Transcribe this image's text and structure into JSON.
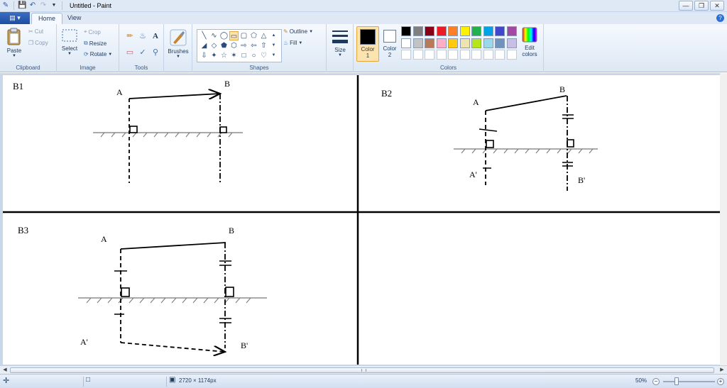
{
  "window": {
    "title": "Untitled - Paint",
    "controls": [
      "minimize",
      "restore",
      "close"
    ]
  },
  "tabs": {
    "file_label": "",
    "items": [
      {
        "label": "Home",
        "active": true
      },
      {
        "label": "View",
        "active": false
      }
    ]
  },
  "ribbon": {
    "clipboard": {
      "group_label": "Clipboard",
      "paste": "Paste",
      "cut": "Cut",
      "copy": "Copy"
    },
    "image": {
      "group_label": "Image",
      "select": "Select",
      "crop": "Crop",
      "resize": "Resize",
      "rotate": "Rotate"
    },
    "tools": {
      "group_label": "Tools"
    },
    "brushes": {
      "label": "Brushes"
    },
    "shapes": {
      "group_label": "Shapes",
      "outline": "Outline",
      "fill": "Fill"
    },
    "size": {
      "label": "Size"
    },
    "colors": {
      "group_label": "Colors",
      "color1_label": "Color",
      "color1_num": "1",
      "color2_label": "Color",
      "color2_num": "2",
      "edit_label": "Edit",
      "edit_label2": "colors",
      "color1": "#000000",
      "color2": "#ffffff",
      "palette_row1": [
        "#000000",
        "#7f7f7f",
        "#880015",
        "#ed1c24",
        "#ff7f27",
        "#fff200",
        "#22b14c",
        "#00a2e8",
        "#3f48cc",
        "#a349a4"
      ],
      "palette_row2": [
        "#ffffff",
        "#c3c3c3",
        "#b97a57",
        "#ffaec9",
        "#ffc90e",
        "#efe4b0",
        "#b5e61d",
        "#99d9ea",
        "#7092be",
        "#c8bfe7"
      ],
      "palette_row3": [
        "#ffffff",
        "#ffffff",
        "#ffffff",
        "#ffffff",
        "#ffffff",
        "#ffffff",
        "#ffffff",
        "#ffffff",
        "#ffffff",
        "#ffffff"
      ]
    }
  },
  "drawing": {
    "b1": {
      "label": "B1",
      "a": "A",
      "b": "B"
    },
    "b2": {
      "label": "B2",
      "a": "A",
      "b": "B",
      "a_prime": "A'",
      "b_prime": "B'"
    },
    "b3": {
      "label": "B3",
      "a": "A",
      "b": "B",
      "a_prime": "A'",
      "b_prime": "B'"
    }
  },
  "statusbar": {
    "dimensions": "2720 × 1174px",
    "zoom": "50%"
  }
}
